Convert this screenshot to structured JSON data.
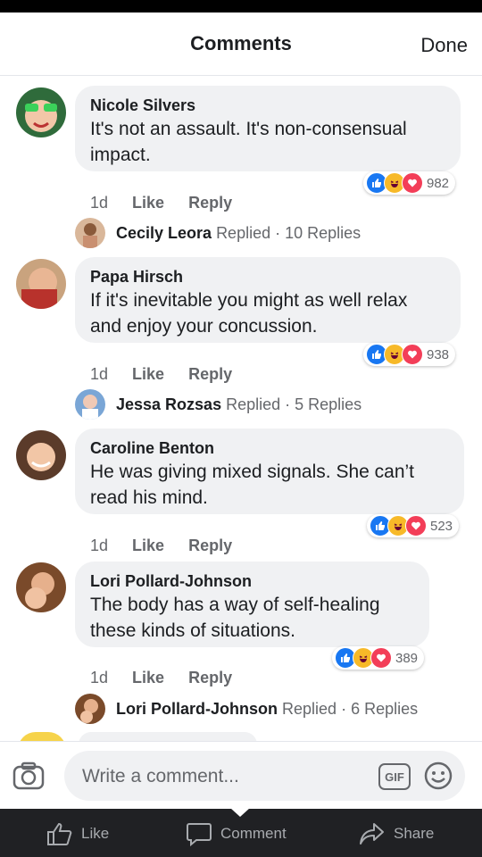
{
  "header": {
    "title": "Comments",
    "done_label": "Done"
  },
  "comments": [
    {
      "author": "Nicole Silvers",
      "text": "It's not an assault. It's non-consensual\nimpact.",
      "time": "1d",
      "like_label": "Like",
      "reply_label": "Reply",
      "reaction_count": "982",
      "replied": {
        "name": "Cecily Leora",
        "label": "Replied",
        "count": "10 Replies"
      }
    },
    {
      "author": "Papa Hirsch",
      "text": "If it's inevitable you might as well relax\nand enjoy your concussion.",
      "time": "1d",
      "like_label": "Like",
      "reply_label": "Reply",
      "reaction_count": "938",
      "replied": {
        "name": "Jessa Rozsas",
        "label": "Replied",
        "count": "5 Replies"
      }
    },
    {
      "author": "Caroline Benton",
      "text": "He was giving mixed signals. She can’t\nread his mind.",
      "time": "1d",
      "like_label": "Like",
      "reply_label": "Reply",
      "reaction_count": "523"
    },
    {
      "author": "Lori Pollard-Johnson",
      "text": "The body has a way of self-healing\nthese kinds of situations.",
      "time": "1d",
      "like_label": "Like",
      "reply_label": "Reply",
      "reaction_count": "389",
      "replied": {
        "name": "Lori Pollard-Johnson",
        "label": "Replied",
        "count": "6 Replies"
      }
    }
  ],
  "composer": {
    "placeholder": "Write a comment...",
    "gif_label": "GIF"
  },
  "bottom_bar": {
    "like_label": "Like",
    "comment_label": "Comment",
    "share_label": "Share"
  },
  "icons": [
    "camera-icon",
    "gif-icon",
    "emoji-icon",
    "like-reaction-icon",
    "haha-reaction-icon",
    "love-reaction-icon",
    "thumbs-up-icon",
    "speech-bubble-icon",
    "share-arrow-icon"
  ],
  "colors": {
    "like_blue": "#1877f2",
    "love_red": "#f33e58",
    "haha_yellow": "#f7b928",
    "bottom_bar": "#202124"
  }
}
